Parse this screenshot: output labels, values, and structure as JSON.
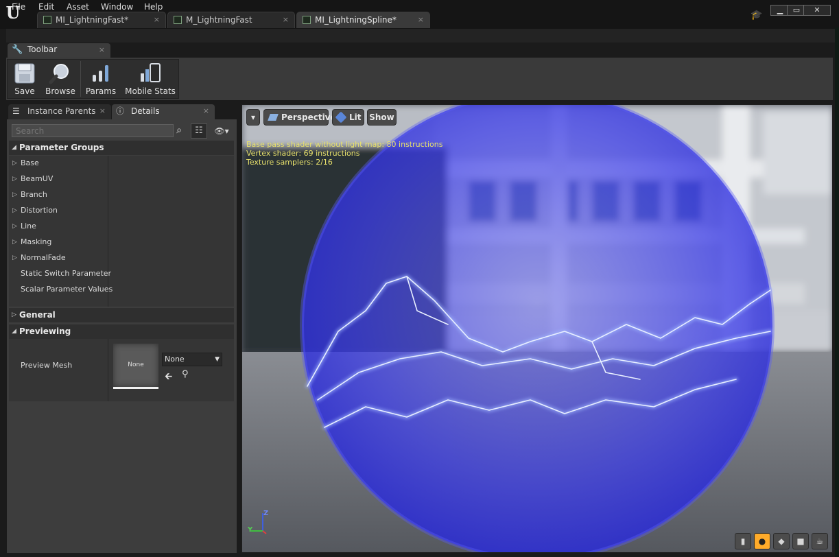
{
  "tabs": [
    {
      "label": "MI_LightningFast*",
      "close": "×"
    },
    {
      "label": "M_LightningFast",
      "close": "×"
    },
    {
      "label": "MI_LightningSpline*",
      "close": "×"
    }
  ],
  "window_controls": {
    "minimize": "▁",
    "maximize": "▭",
    "close": "✕"
  },
  "menu": [
    "File",
    "Edit",
    "Asset",
    "Window",
    "Help"
  ],
  "toolbar_tab": {
    "label": "Toolbar",
    "close": "×"
  },
  "toolbar": {
    "save": "Save",
    "browse": "Browse",
    "params": "Params",
    "mobile_stats": "Mobile Stats"
  },
  "panel_tabs": {
    "instance_parents": "Instance Parents",
    "details": "Details",
    "close": "×"
  },
  "search": {
    "placeholder": "Search"
  },
  "categories": {
    "parameter_groups": "Parameter Groups",
    "general": "General",
    "previewing": "Previewing"
  },
  "parameter_groups": [
    "Base",
    "BeamUV",
    "Branch",
    "Distortion",
    "Line",
    "Masking",
    "NormalFade",
    "Static Switch Parameter",
    "Scalar Parameter Values"
  ],
  "preview": {
    "label": "Preview Mesh",
    "thumb_text": "None",
    "combo_value": "None"
  },
  "viewport": {
    "menu_arrow": "▾",
    "perspective": "Perspective",
    "lit": "Lit",
    "show": "Show",
    "stats": [
      "Base pass shader without light map: 80 instructions",
      "Vertex shader: 69 instructions",
      "Texture samplers: 2/16"
    ],
    "axis_y": "Y",
    "axis_z": "Z"
  },
  "colors": {
    "accent": "#ffab2a",
    "stats_text": "#e8e16c",
    "lightning": "#3a3cf0"
  }
}
